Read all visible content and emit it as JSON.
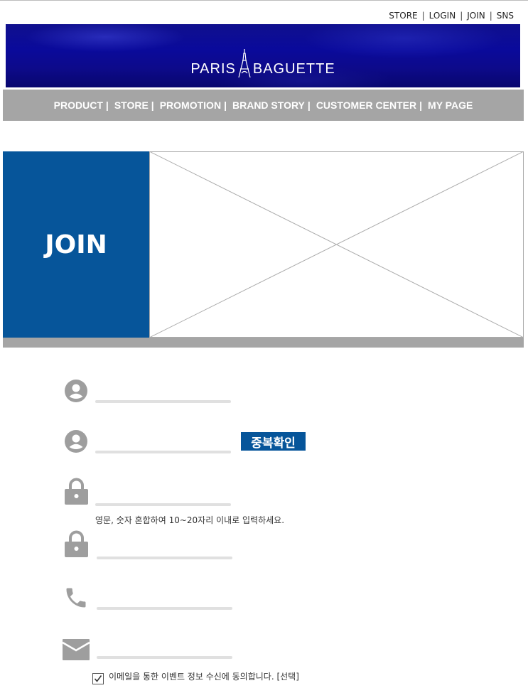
{
  "top_nav": [
    "STORE",
    "LOGIN",
    "JOIN",
    "SNS"
  ],
  "brand": {
    "left": "PARIS",
    "right": "BAGUETTE"
  },
  "main_nav": [
    "PRODUCT",
    "STORE",
    "PROMOTION",
    "BRAND STORY",
    "CUSTOMER CENTER",
    "MY PAGE"
  ],
  "hero": {
    "title": "JOIN"
  },
  "form": {
    "duplicate_check_label": "중복확인",
    "password_hint": "영문, 숫자 혼합하여 10~20자리 이내로 입력하세요.",
    "email_agree_label": "이메일을 통한 이벤트 정보 수신에 동의합니다. [선택]",
    "email_agree_checked": true
  },
  "colors": {
    "brand_blue": "#06559a",
    "nav_gray": "#a5a5a5",
    "banner_blue": "#0a0a9b"
  }
}
